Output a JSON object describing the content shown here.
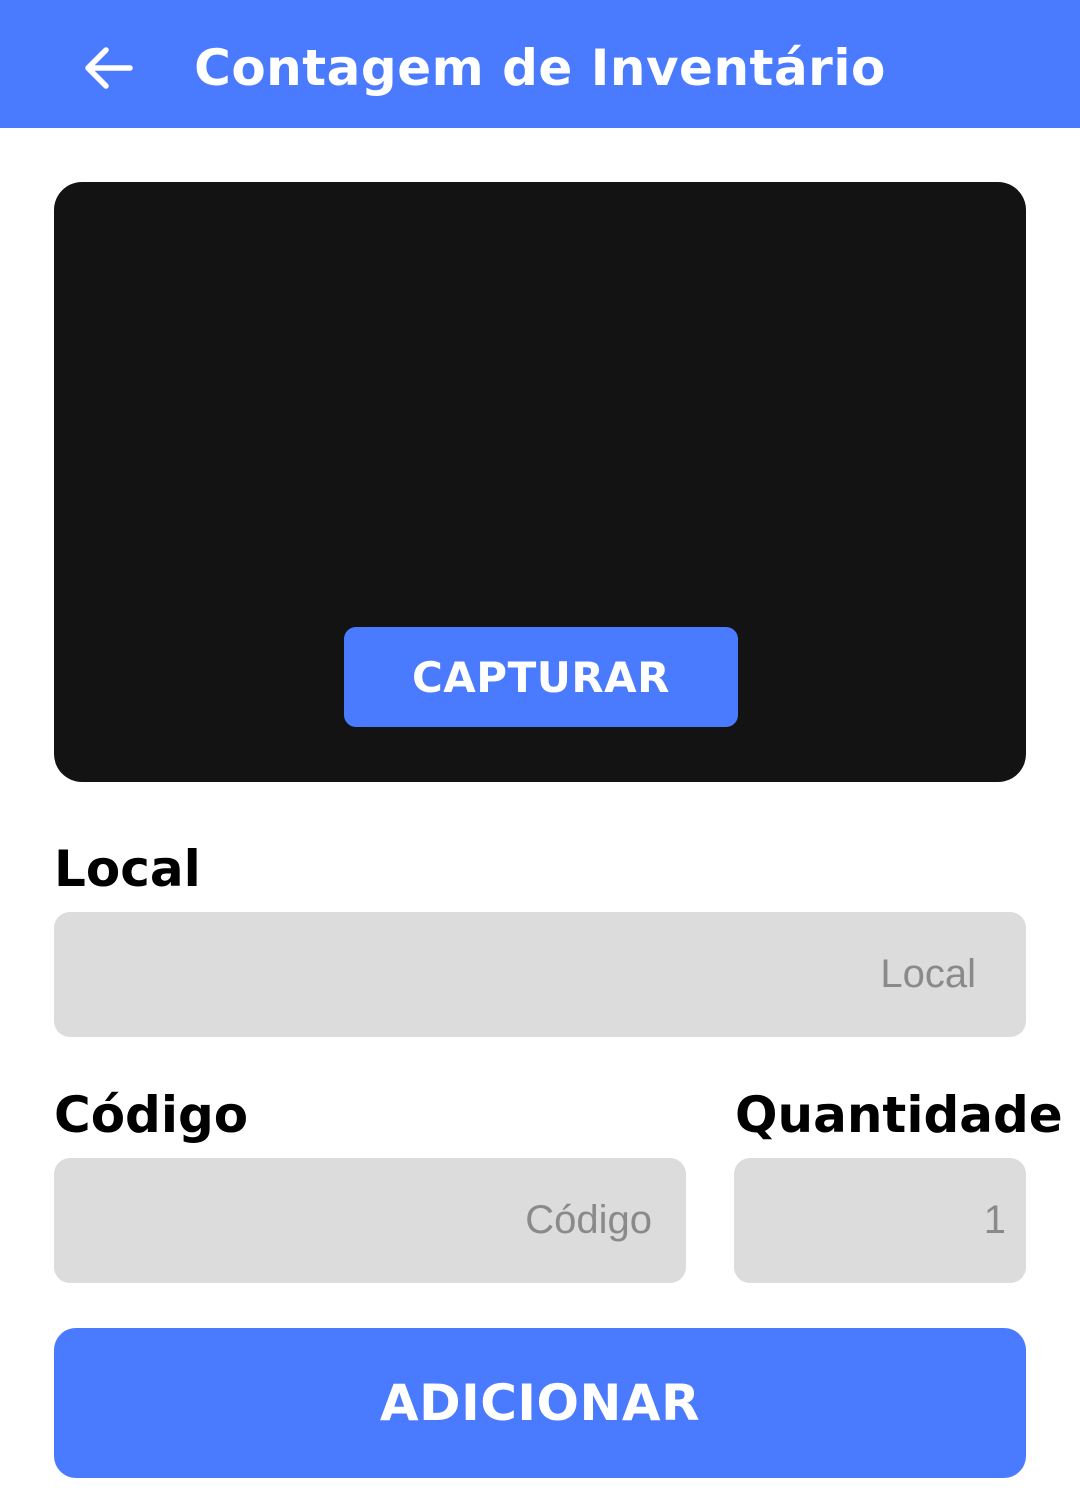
{
  "app_bar": {
    "title": "Contagem de Inventário",
    "back_icon": "arrow-left-icon",
    "color": "#4a7afe"
  },
  "camera": {
    "capture_label": "CAPTURAR",
    "background": "#121312"
  },
  "form": {
    "local": {
      "label": "Local",
      "placeholder": "Local",
      "value": ""
    },
    "codigo": {
      "label": "Código",
      "placeholder": "Código",
      "value": ""
    },
    "quantidade": {
      "label": "Quantidade",
      "placeholder": "1",
      "value": ""
    }
  },
  "actions": {
    "add_label": "ADICIONAR"
  }
}
